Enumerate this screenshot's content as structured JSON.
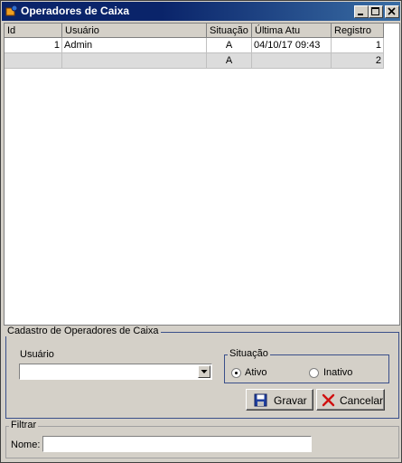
{
  "window": {
    "title": "Operadores de Caixa"
  },
  "grid": {
    "columns": [
      "Id",
      "Usuário",
      "Situação",
      "Última Atu",
      "Registro"
    ],
    "rows": [
      [
        "1",
        "Admin",
        "A",
        "04/10/17 09:43",
        "1"
      ],
      [
        "",
        "",
        "A",
        "",
        "2"
      ]
    ]
  },
  "cadastro": {
    "legend": "Cadastro de Operadores de Caixa",
    "usuario_label": "Usuário",
    "usuario_value": "",
    "situacao_legend": "Situação",
    "options": [
      "Ativo",
      "Inativo"
    ],
    "selected": "Ativo",
    "save_label": "Gravar",
    "cancel_label": "Cancelar"
  },
  "filtrar": {
    "legend": "Filtrar",
    "nome_label": "Nome:",
    "nome_value": ""
  }
}
